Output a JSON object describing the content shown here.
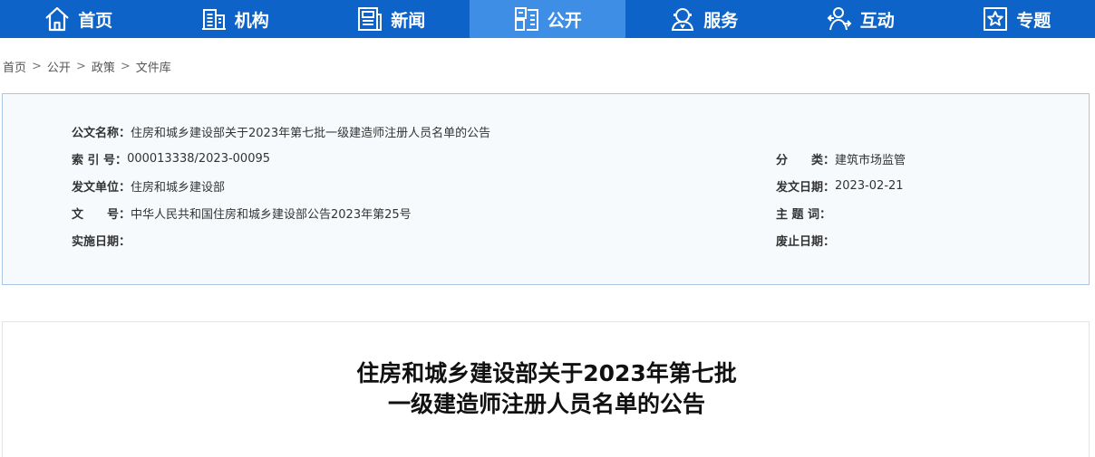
{
  "nav": {
    "items": [
      {
        "label": "首页",
        "icon": "home-icon"
      },
      {
        "label": "机构",
        "icon": "building-icon"
      },
      {
        "label": "新闻",
        "icon": "news-icon"
      },
      {
        "label": "公开",
        "icon": "document-icon"
      },
      {
        "label": "服务",
        "icon": "service-icon"
      },
      {
        "label": "互动",
        "icon": "interaction-icon"
      },
      {
        "label": "专题",
        "icon": "star-icon"
      }
    ],
    "active_index": 3,
    "colors": {
      "bar": "#0d63c7",
      "active": "#3f8ee6"
    }
  },
  "breadcrumb": [
    "首页",
    "公开",
    "政策",
    "文件库"
  ],
  "breadcrumb_sep": ">",
  "meta": {
    "title_key": "公文名称：",
    "title_value": "住房和城乡建设部关于2023年第七批一级建造师注册人员名单的公告",
    "index_key": "索 引 号：",
    "index_value": "000013338/2023-00095",
    "category_key": "分　　类：",
    "category_value": "建筑市场监管",
    "issuer_key": "发文单位：",
    "issuer_value": "住房和城乡建设部",
    "date_key": "发文日期：",
    "date_value": "2023-02-21",
    "docno_key": "文　　号：",
    "docno_value": "中华人民共和国住房和城乡建设部公告2023年第25号",
    "subject_key": "主 题 词：",
    "subject_value": "",
    "effective_key": "实施日期：",
    "effective_value": "",
    "expire_key": "废止日期：",
    "expire_value": ""
  },
  "article": {
    "title_line1": "住房和城乡建设部关于2023年第七批",
    "title_line2": "一级建造师注册人员名单的公告"
  }
}
